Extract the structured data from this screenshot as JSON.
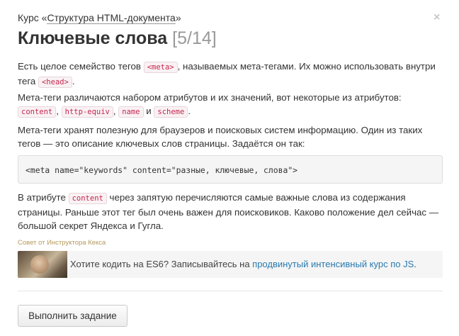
{
  "header": {
    "course_prefix": "Курс «",
    "course_link": "Структура HTML-документа",
    "course_suffix": "»",
    "close_symbol": "×"
  },
  "lesson": {
    "title": "Ключевые слова",
    "progress": "[5/14]"
  },
  "paragraph1": {
    "t1": "Есть целое семейство тегов ",
    "c1": "<meta>",
    "t2": ", называемых мета-тегами. Их можно использовать внутри тега ",
    "c2": "<head>",
    "t3": "."
  },
  "paragraph2": {
    "t1": "Мета-теги различаются набором атрибутов и их значений, вот некоторые из атрибутов: ",
    "c1": "content",
    "t2": ", ",
    "c2": "http-equiv",
    "t3": ", ",
    "c3": "name",
    "t4": " и ",
    "c4": "scheme",
    "t5": "."
  },
  "paragraph3": {
    "text": "Мета-теги хранят полезную для браузеров и поисковых систем информацию. Один из таких тегов — это описание ключевых слов страницы. Задаётся он так:"
  },
  "code_example": "<meta name=\"keywords\" content=\"разные, ключевые, слова\">",
  "paragraph4": {
    "t1": "В атрибуте ",
    "c1": "content",
    "t2": " через запятую перечисляются самые важные слова из содержания страницы. Раньше этот тег был очень важен для поисковиков. Каково положение дел сейчас — большой секрет Яндекса и Гугла."
  },
  "tip": {
    "label": "Совет от Инструктора Кекса",
    "text": "Хотите кодить на ES6? Записывайтесь на ",
    "link": "продвинутый интенсивный курс по JS",
    "suffix": "."
  },
  "action": {
    "button_label": "Выполнить задание"
  }
}
